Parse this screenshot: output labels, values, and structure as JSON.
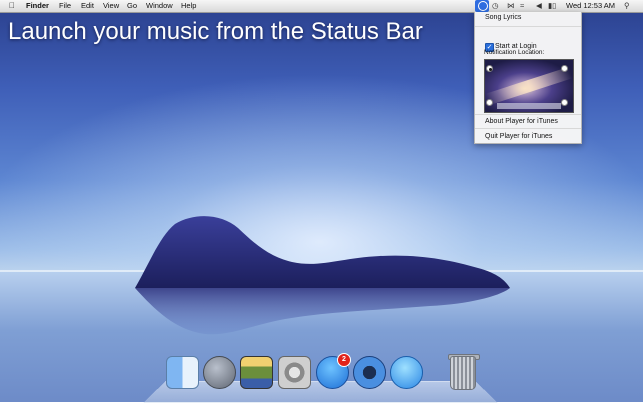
{
  "headline": "Launch your music from the Status Bar",
  "menubar": {
    "apple_icon": "apple-icon",
    "app_name": "Finder",
    "items": [
      "File",
      "Edit",
      "View",
      "Go",
      "Window",
      "Help"
    ],
    "clock": "Wed 12:53 AM",
    "status_icons": [
      "player-for-itunes-icon",
      "time-machine-icon",
      "bluetooth-icon",
      "wifi-icon",
      "volume-icon",
      "battery-icon",
      "spotlight-icon"
    ]
  },
  "menu": {
    "song_lyrics": "Song Lyrics",
    "start_at_login": "Start at Login",
    "start_at_login_checked": true,
    "notification_location_label": "Notification Location:",
    "selected_location": "top-left",
    "about": "About Player for iTunes",
    "quit": "Quit Player for iTunes"
  },
  "dock": {
    "icons": [
      "finder-icon",
      "launchpad-icon",
      "photo-icon",
      "system-preferences-icon",
      "app-store-icon",
      "quicktime-icon",
      "itunes-icon",
      "trash-icon"
    ],
    "app_store_badge": "2"
  },
  "colors": {
    "accent": "#2a6fdc",
    "badge": "#e2231a"
  }
}
